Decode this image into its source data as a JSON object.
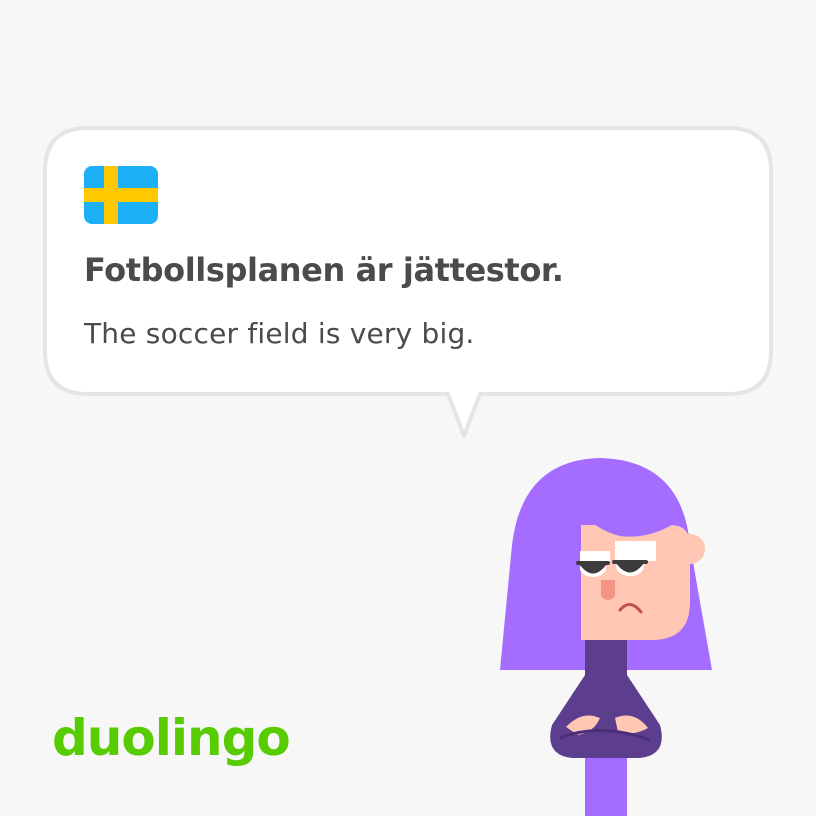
{
  "card": {
    "flag_icon": "sweden-flag-icon",
    "sentence": "Fotbollsplanen är jättestor.",
    "translation": "The soccer field is very big."
  },
  "brand": {
    "logo_text": "duolingo"
  },
  "character_icon": "lily-character-arms-crossed",
  "colors": {
    "background": "#f7f7f8",
    "bubble_fill": "#ffffff",
    "bubble_border": "#e5e5e5",
    "text": "#4b4b4b",
    "brand_green": "#58cc02",
    "flag_blue": "#1cb0f6",
    "flag_yellow": "#ffc800",
    "hair_purple": "#a56dff",
    "shirt_purple": "#5c3d8e",
    "skin": "#ffc7b4"
  }
}
